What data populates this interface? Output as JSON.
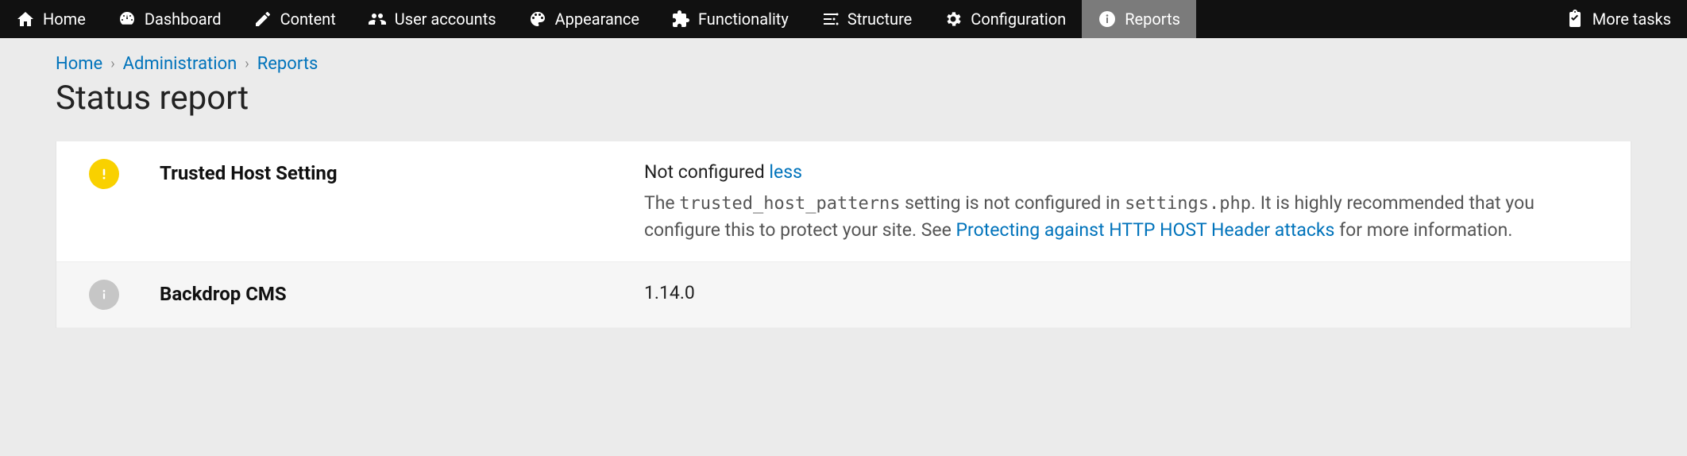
{
  "admin_bar": {
    "items": [
      {
        "id": "home",
        "label": "Home",
        "icon": "home"
      },
      {
        "id": "dashboard",
        "label": "Dashboard",
        "icon": "dashboard"
      },
      {
        "id": "content",
        "label": "Content",
        "icon": "pencil"
      },
      {
        "id": "user-accounts",
        "label": "User accounts",
        "icon": "users"
      },
      {
        "id": "appearance",
        "label": "Appearance",
        "icon": "palette"
      },
      {
        "id": "functionality",
        "label": "Functionality",
        "icon": "puzzle"
      },
      {
        "id": "structure",
        "label": "Structure",
        "icon": "structure"
      },
      {
        "id": "configuration",
        "label": "Configuration",
        "icon": "gear"
      },
      {
        "id": "reports",
        "label": "Reports",
        "icon": "info",
        "active": true
      }
    ],
    "right": {
      "id": "more-tasks",
      "label": "More tasks",
      "icon": "clipboard"
    }
  },
  "breadcrumb": [
    {
      "label": "Home"
    },
    {
      "label": "Administration"
    },
    {
      "label": "Reports"
    }
  ],
  "page_title": "Status report",
  "status": {
    "rows": [
      {
        "severity": "warn",
        "label": "Trusted Host Setting",
        "value": "Not configured",
        "toggle": "less",
        "desc_pre": "The ",
        "desc_code1": "trusted_host_patterns",
        "desc_mid1": " setting is not configured in ",
        "desc_code2": "settings.php",
        "desc_mid2": ". It is highly recommended that you configure this to protect your site. See ",
        "desc_link": "Protecting against HTTP HOST Header attacks",
        "desc_post": " for more information."
      },
      {
        "severity": "info",
        "label": "Backdrop CMS",
        "value": "1.14.0"
      }
    ]
  },
  "colors": {
    "link": "#0073bb",
    "warn_badge": "#f9d100",
    "info_badge": "#c6c6c6",
    "admin_bar_bg": "#111111",
    "admin_bar_active": "#7b7b7b"
  }
}
